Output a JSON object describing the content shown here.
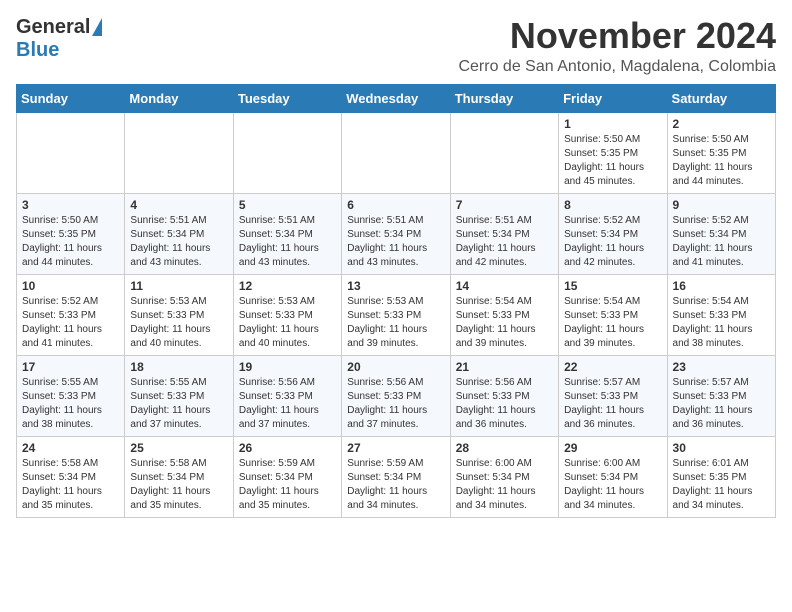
{
  "header": {
    "logo_general": "General",
    "logo_blue": "Blue",
    "month_title": "November 2024",
    "location": "Cerro de San Antonio, Magdalena, Colombia"
  },
  "days_of_week": [
    "Sunday",
    "Monday",
    "Tuesday",
    "Wednesday",
    "Thursday",
    "Friday",
    "Saturday"
  ],
  "weeks": [
    [
      {
        "day": "",
        "info": ""
      },
      {
        "day": "",
        "info": ""
      },
      {
        "day": "",
        "info": ""
      },
      {
        "day": "",
        "info": ""
      },
      {
        "day": "",
        "info": ""
      },
      {
        "day": "1",
        "info": "Sunrise: 5:50 AM\nSunset: 5:35 PM\nDaylight: 11 hours\nand 45 minutes."
      },
      {
        "day": "2",
        "info": "Sunrise: 5:50 AM\nSunset: 5:35 PM\nDaylight: 11 hours\nand 44 minutes."
      }
    ],
    [
      {
        "day": "3",
        "info": "Sunrise: 5:50 AM\nSunset: 5:35 PM\nDaylight: 11 hours\nand 44 minutes."
      },
      {
        "day": "4",
        "info": "Sunrise: 5:51 AM\nSunset: 5:34 PM\nDaylight: 11 hours\nand 43 minutes."
      },
      {
        "day": "5",
        "info": "Sunrise: 5:51 AM\nSunset: 5:34 PM\nDaylight: 11 hours\nand 43 minutes."
      },
      {
        "day": "6",
        "info": "Sunrise: 5:51 AM\nSunset: 5:34 PM\nDaylight: 11 hours\nand 43 minutes."
      },
      {
        "day": "7",
        "info": "Sunrise: 5:51 AM\nSunset: 5:34 PM\nDaylight: 11 hours\nand 42 minutes."
      },
      {
        "day": "8",
        "info": "Sunrise: 5:52 AM\nSunset: 5:34 PM\nDaylight: 11 hours\nand 42 minutes."
      },
      {
        "day": "9",
        "info": "Sunrise: 5:52 AM\nSunset: 5:34 PM\nDaylight: 11 hours\nand 41 minutes."
      }
    ],
    [
      {
        "day": "10",
        "info": "Sunrise: 5:52 AM\nSunset: 5:33 PM\nDaylight: 11 hours\nand 41 minutes."
      },
      {
        "day": "11",
        "info": "Sunrise: 5:53 AM\nSunset: 5:33 PM\nDaylight: 11 hours\nand 40 minutes."
      },
      {
        "day": "12",
        "info": "Sunrise: 5:53 AM\nSunset: 5:33 PM\nDaylight: 11 hours\nand 40 minutes."
      },
      {
        "day": "13",
        "info": "Sunrise: 5:53 AM\nSunset: 5:33 PM\nDaylight: 11 hours\nand 39 minutes."
      },
      {
        "day": "14",
        "info": "Sunrise: 5:54 AM\nSunset: 5:33 PM\nDaylight: 11 hours\nand 39 minutes."
      },
      {
        "day": "15",
        "info": "Sunrise: 5:54 AM\nSunset: 5:33 PM\nDaylight: 11 hours\nand 39 minutes."
      },
      {
        "day": "16",
        "info": "Sunrise: 5:54 AM\nSunset: 5:33 PM\nDaylight: 11 hours\nand 38 minutes."
      }
    ],
    [
      {
        "day": "17",
        "info": "Sunrise: 5:55 AM\nSunset: 5:33 PM\nDaylight: 11 hours\nand 38 minutes."
      },
      {
        "day": "18",
        "info": "Sunrise: 5:55 AM\nSunset: 5:33 PM\nDaylight: 11 hours\nand 37 minutes."
      },
      {
        "day": "19",
        "info": "Sunrise: 5:56 AM\nSunset: 5:33 PM\nDaylight: 11 hours\nand 37 minutes."
      },
      {
        "day": "20",
        "info": "Sunrise: 5:56 AM\nSunset: 5:33 PM\nDaylight: 11 hours\nand 37 minutes."
      },
      {
        "day": "21",
        "info": "Sunrise: 5:56 AM\nSunset: 5:33 PM\nDaylight: 11 hours\nand 36 minutes."
      },
      {
        "day": "22",
        "info": "Sunrise: 5:57 AM\nSunset: 5:33 PM\nDaylight: 11 hours\nand 36 minutes."
      },
      {
        "day": "23",
        "info": "Sunrise: 5:57 AM\nSunset: 5:33 PM\nDaylight: 11 hours\nand 36 minutes."
      }
    ],
    [
      {
        "day": "24",
        "info": "Sunrise: 5:58 AM\nSunset: 5:34 PM\nDaylight: 11 hours\nand 35 minutes."
      },
      {
        "day": "25",
        "info": "Sunrise: 5:58 AM\nSunset: 5:34 PM\nDaylight: 11 hours\nand 35 minutes."
      },
      {
        "day": "26",
        "info": "Sunrise: 5:59 AM\nSunset: 5:34 PM\nDaylight: 11 hours\nand 35 minutes."
      },
      {
        "day": "27",
        "info": "Sunrise: 5:59 AM\nSunset: 5:34 PM\nDaylight: 11 hours\nand 34 minutes."
      },
      {
        "day": "28",
        "info": "Sunrise: 6:00 AM\nSunset: 5:34 PM\nDaylight: 11 hours\nand 34 minutes."
      },
      {
        "day": "29",
        "info": "Sunrise: 6:00 AM\nSunset: 5:34 PM\nDaylight: 11 hours\nand 34 minutes."
      },
      {
        "day": "30",
        "info": "Sunrise: 6:01 AM\nSunset: 5:35 PM\nDaylight: 11 hours\nand 34 minutes."
      }
    ]
  ]
}
